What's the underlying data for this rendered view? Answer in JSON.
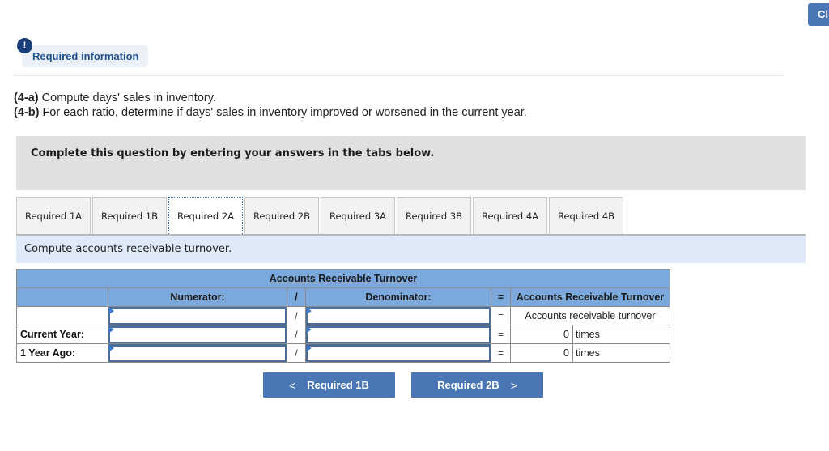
{
  "corner_button": {
    "label": "Cl"
  },
  "required_info": {
    "icon": "!",
    "label": "Required information"
  },
  "instructions": [
    {
      "tag": "(4-a)",
      "text": " Compute days' sales in inventory."
    },
    {
      "tag": "(4-b)",
      "text": " For each ratio, determine if days' sales in inventory improved or worsened in the current year."
    }
  ],
  "banner": "Complete this question by entering your answers in the tabs below.",
  "tabs": [
    {
      "label": "Required 1A",
      "active": false
    },
    {
      "label": "Required 1B",
      "active": false
    },
    {
      "label": "Required 2A",
      "active": true
    },
    {
      "label": "Required 2B",
      "active": false
    },
    {
      "label": "Required 3A",
      "active": false
    },
    {
      "label": "Required 3B",
      "active": false
    },
    {
      "label": "Required 4A",
      "active": false
    },
    {
      "label": "Required 4B",
      "active": false
    }
  ],
  "prompt": "Compute accounts receivable turnover.",
  "table": {
    "title": "Accounts Receivable Turnover",
    "headers": {
      "numerator": "Numerator:",
      "divide": "/",
      "denominator": "Denominator:",
      "equals": "=",
      "result": "Accounts Receivable Turnover"
    },
    "rows": [
      {
        "label": "",
        "numerator": "",
        "divide": "/",
        "denominator": "",
        "equals": "=",
        "result_label": "Accounts receivable turnover"
      },
      {
        "label": "Current Year:",
        "numerator": "",
        "divide": "/",
        "denominator": "",
        "equals": "=",
        "result_value": "0",
        "result_unit": "times"
      },
      {
        "label": "1 Year Ago:",
        "numerator": "",
        "divide": "/",
        "denominator": "",
        "equals": "=",
        "result_value": "0",
        "result_unit": "times"
      }
    ]
  },
  "nav": {
    "prev": {
      "icon": "chevron-left",
      "glyph": "<",
      "label": "Required 1B"
    },
    "next": {
      "icon": "chevron-right",
      "glyph": ">",
      "label": "Required 2B"
    }
  },
  "colors": {
    "accent": "#4a77b4",
    "table_header": "#7ba9dc",
    "prompt_bg": "#deeaf7",
    "banner_bg": "#e0e0e0",
    "badge_bg": "#ebf0f7",
    "badge_text": "#1e4f8c"
  }
}
